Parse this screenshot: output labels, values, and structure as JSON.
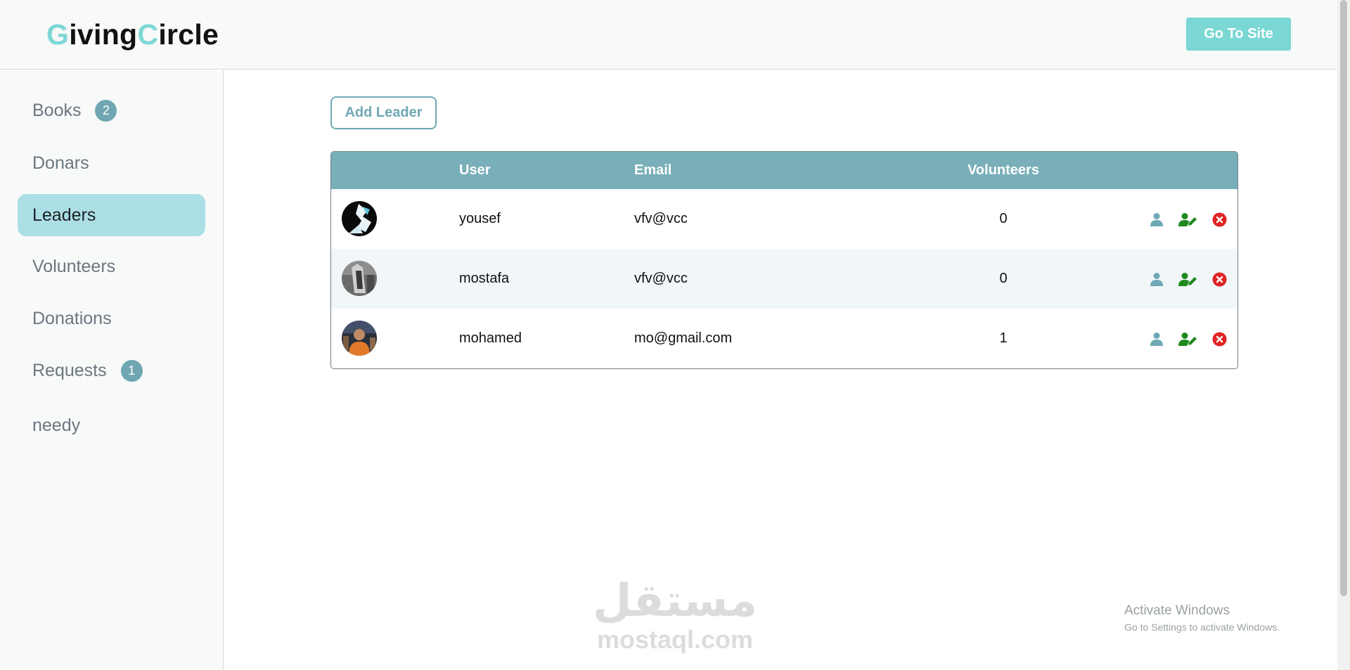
{
  "brand": {
    "part1_accent": "G",
    "part1_rest": "iving",
    "part2_accent": "C",
    "part2_rest": "ircle"
  },
  "header": {
    "go_to_site_label": "Go To Site"
  },
  "sidebar": {
    "items": [
      {
        "label": "Books",
        "badge": "2"
      },
      {
        "label": "Donars"
      },
      {
        "label": "Leaders"
      },
      {
        "label": "Volunteers"
      },
      {
        "label": "Donations"
      },
      {
        "label": "Requests",
        "badge": "1"
      },
      {
        "label": "needy"
      }
    ]
  },
  "main": {
    "add_leader_label": "Add Leader",
    "table": {
      "columns": [
        "User",
        "Email",
        "Volunteers"
      ],
      "rows": [
        {
          "name": "yousef",
          "email": "vfv@vcc",
          "volunteers": "0"
        },
        {
          "name": "mostafa",
          "email": "vfv@vcc",
          "volunteers": "0"
        },
        {
          "name": "mohamed",
          "email": "mo@gmail.com",
          "volunteers": "1"
        }
      ]
    }
  },
  "watermark": {
    "arabic": "مستقل",
    "latin": "mostaql.com"
  },
  "os_notice": {
    "title": "Activate Windows",
    "subtitle": "Go to Settings to activate Windows."
  },
  "colors": {
    "accent": "#7ad7d3",
    "table_header": "#78afb8",
    "active_nav": "#acdfe5",
    "edit_icon": "#1e8a1e",
    "delete_icon": "#e02424",
    "user_icon": "#6fa8b5"
  }
}
